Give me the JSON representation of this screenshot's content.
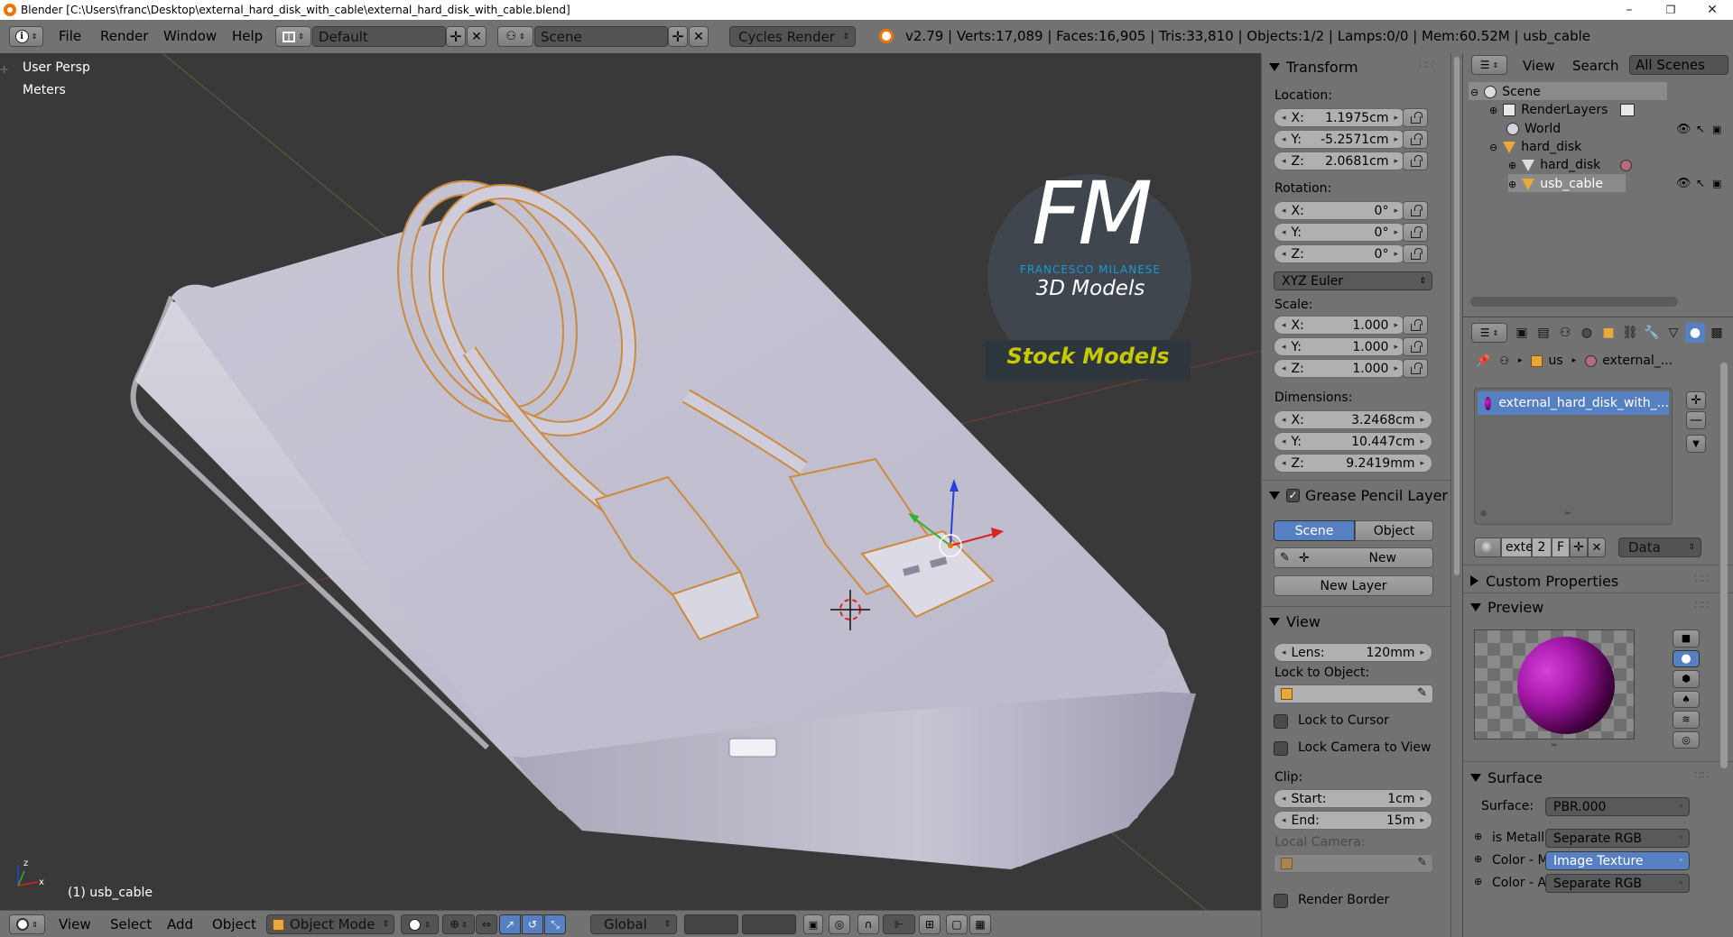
{
  "window": {
    "title": "Blender [C:\\Users\\franc\\Desktop\\external_hard_disk_with_cable\\external_hard_disk_with_cable.blend]",
    "minimize": "–",
    "maximize": "❐",
    "close": "✕"
  },
  "infobar": {
    "menus": [
      "File",
      "Render",
      "Window",
      "Help"
    ],
    "layout": "Default",
    "scene": "Scene",
    "engine": "Cycles Render",
    "stats": "v2.79 | Verts:17,089 | Faces:16,905 | Tris:33,810 | Objects:1/2 | Lamps:0/0 | Mem:60.52M | usb_cable"
  },
  "viewport": {
    "view_label": "User Persp",
    "units_label": "Meters",
    "object_label": "(1) usb_cable",
    "logo": {
      "letters": "FM",
      "name": "FRANCESCO MILANESE",
      "tagline": "3D Models",
      "banner": "Stock Models"
    }
  },
  "viewport_toolbar": {
    "menus": [
      "View",
      "Select",
      "Add",
      "Object"
    ],
    "mode": "Object Mode",
    "orientation": "Global"
  },
  "properties": {
    "transform": {
      "title": "Transform",
      "location_label": "Location:",
      "location": [
        {
          "axis": "X:",
          "value": "1.1975cm"
        },
        {
          "axis": "Y:",
          "value": "-5.2571cm"
        },
        {
          "axis": "Z:",
          "value": "2.0681cm"
        }
      ],
      "rotation_label": "Rotation:",
      "rotation": [
        {
          "axis": "X:",
          "value": "0°"
        },
        {
          "axis": "Y:",
          "value": "0°"
        },
        {
          "axis": "Z:",
          "value": "0°"
        }
      ],
      "rotation_mode": "XYZ Euler",
      "scale_label": "Scale:",
      "scale": [
        {
          "axis": "X:",
          "value": "1.000"
        },
        {
          "axis": "Y:",
          "value": "1.000"
        },
        {
          "axis": "Z:",
          "value": "1.000"
        }
      ],
      "dimensions_label": "Dimensions:",
      "dimensions": [
        {
          "axis": "X:",
          "value": "3.2468cm"
        },
        {
          "axis": "Y:",
          "value": "10.447cm"
        },
        {
          "axis": "Z:",
          "value": "9.2419mm"
        }
      ]
    },
    "grease_pencil": {
      "title": "Grease Pencil Layer",
      "tab_scene": "Scene",
      "tab_object": "Object",
      "new": "New",
      "new_layer": "New Layer"
    },
    "view": {
      "title": "View",
      "lens_label": "Lens:",
      "lens_value": "120mm",
      "lock_object_label": "Lock to Object:",
      "lock_cursor": "Lock to Cursor",
      "lock_camera": "Lock Camera to View",
      "clip_label": "Clip:",
      "clip_start_label": "Start:",
      "clip_start": "1cm",
      "clip_end_label": "End:",
      "clip_end": "15m",
      "local_camera_label": "Local Camera:",
      "render_border": "Render Border"
    }
  },
  "outliner": {
    "menus": [
      "View",
      "Search"
    ],
    "filter": "All Scenes",
    "items": [
      {
        "label": "Scene",
        "icon": "scene-icon"
      },
      {
        "label": "RenderLayers",
        "icon": "renderlayers-icon"
      },
      {
        "label": "World",
        "icon": "world-icon"
      },
      {
        "label": "hard_disk",
        "icon": "object-icon"
      },
      {
        "label": "hard_disk",
        "icon": "mesh-icon"
      },
      {
        "label": "usb_cable",
        "icon": "object-icon"
      }
    ]
  },
  "material": {
    "breadcrumb": [
      "us",
      "external_..."
    ],
    "slot": "external_hard_disk_with_...",
    "datablock_short": "exte",
    "users": "2",
    "fake": "F",
    "link": "Data",
    "custom_props": "Custom Properties",
    "preview": "Preview",
    "surface_title": "Surface",
    "surface_label": "Surface:",
    "surface_value": "PBR.000",
    "inputs": [
      {
        "label": "is Metallic",
        "value": "Separate RGB"
      },
      {
        "label": "Color - Ma",
        "value": "Image Texture"
      },
      {
        "label": "Color - Ab",
        "value": "Separate RGB"
      }
    ]
  },
  "colors": {
    "panel": "#727272",
    "viewport": "#393939",
    "selected": "#5680c2",
    "logo_blue": "#1a9ad6",
    "logo_yellow": "#c8c800"
  }
}
